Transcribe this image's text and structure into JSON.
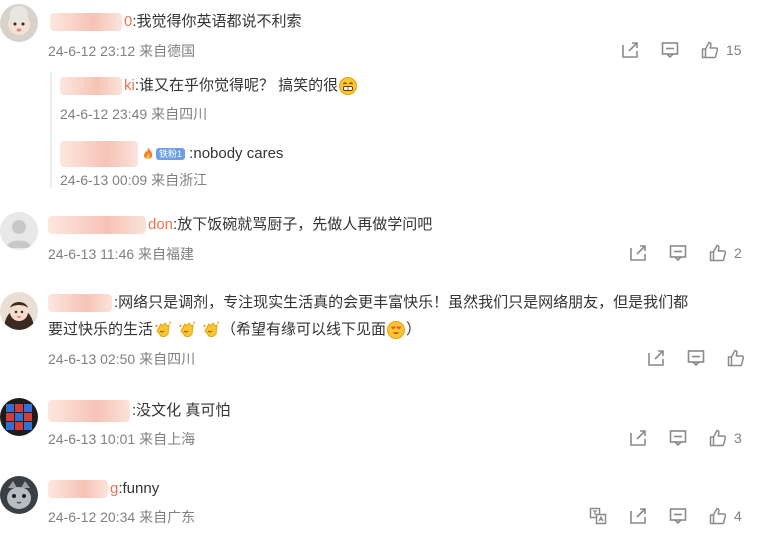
{
  "comments": [
    {
      "name_suffix": "0",
      "text": ":我觉得你英语都说不利索",
      "date": "24-6-12 23:12",
      "location": "来自德国",
      "likes": "15",
      "replies": [
        {
          "name_suffix": "ki",
          "text": ":谁又在乎你觉得呢？ 搞笑的很",
          "date": "24-6-12 23:49",
          "location": "来自四川"
        },
        {
          "badge": "铁粉1",
          "text": " :nobody cares",
          "date": "24-6-13 00:09",
          "location": "来自浙江"
        }
      ]
    },
    {
      "name_suffix": "don",
      "text": ":放下饭碗就骂厨子，先做人再做学问吧",
      "date": "24-6-13 11:46",
      "location": "来自福建",
      "likes": "2"
    },
    {
      "text_line1": ":网络只是调剂，专注现实生活真的会更丰富快乐！虽然我们只是网络朋友，但是我们都",
      "text_line2_a": "要过快乐的生活",
      "text_line2_b": "（希望有缘可以线下见面",
      "text_line2_c": "）",
      "date": "24-6-13 02:50",
      "location": "来自四川",
      "likes": ""
    },
    {
      "text": ":没文化 真可怕",
      "date": "24-6-13 10:01",
      "location": "来自上海",
      "likes": "3"
    },
    {
      "name_suffix": "g",
      "text": ":funny",
      "date": "24-6-12 20:34",
      "location": "来自广东",
      "likes": "4"
    }
  ],
  "icons": {
    "share": "share-icon",
    "comment": "comment-icon",
    "like": "like-icon",
    "translate": "translate-icon"
  }
}
